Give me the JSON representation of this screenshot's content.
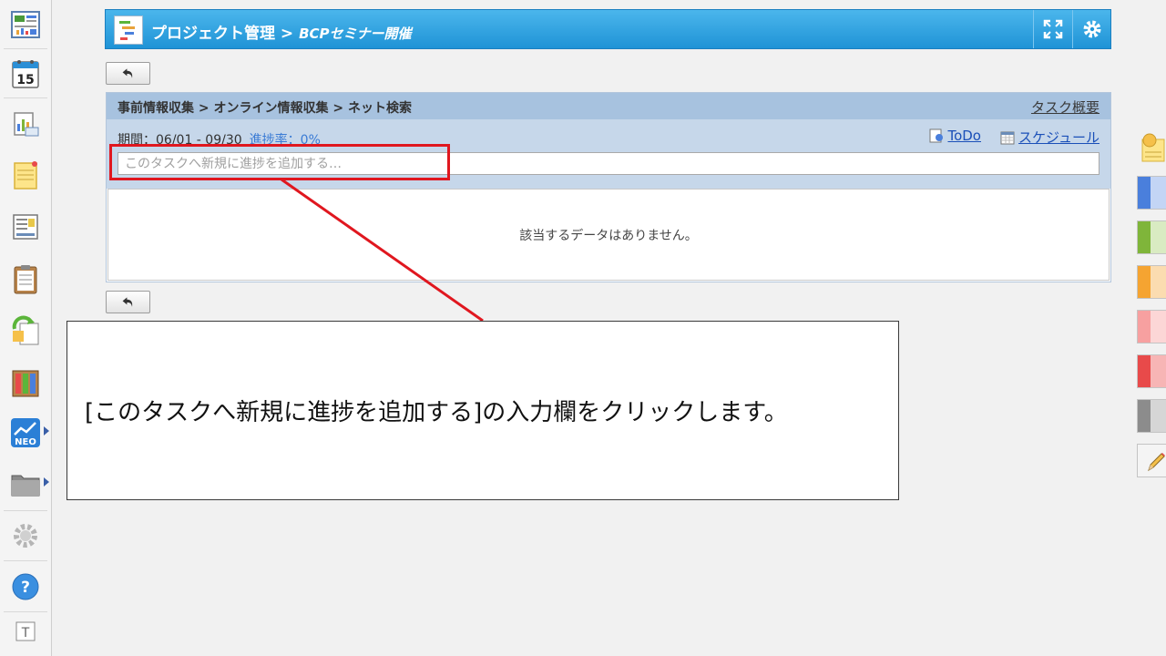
{
  "titlebar": {
    "app_title": "プロジェクト管理",
    "separator": " > ",
    "project_name": "BCPセミナー開催"
  },
  "task": {
    "breadcrumb": "事前情報収集 > オンライン情報収集 > ネット検索",
    "overview_link": "タスク概要",
    "period": "期間：06/01 - 09/30",
    "progress_rate": "進捗率：0%",
    "todo_link": "ToDo",
    "schedule_link": "スケジュール",
    "input_placeholder": "このタスクへ新規に進捗を追加する…",
    "empty_message": "該当するデータはありません。"
  },
  "callout": {
    "text": "[このタスクへ新規に進捗を追加する]の入力欄をクリックします。"
  },
  "colors": {
    "titlebar": "#2aa3e0",
    "highlight": "#e0171f",
    "link": "#1a4fb8",
    "progress": "#3a7bd5"
  },
  "right_tabs": [
    "#4a7fdc",
    "#7fb53a",
    "#f5a431",
    "#f7a0a0",
    "#e84a4a",
    "#8c8c8c"
  ]
}
